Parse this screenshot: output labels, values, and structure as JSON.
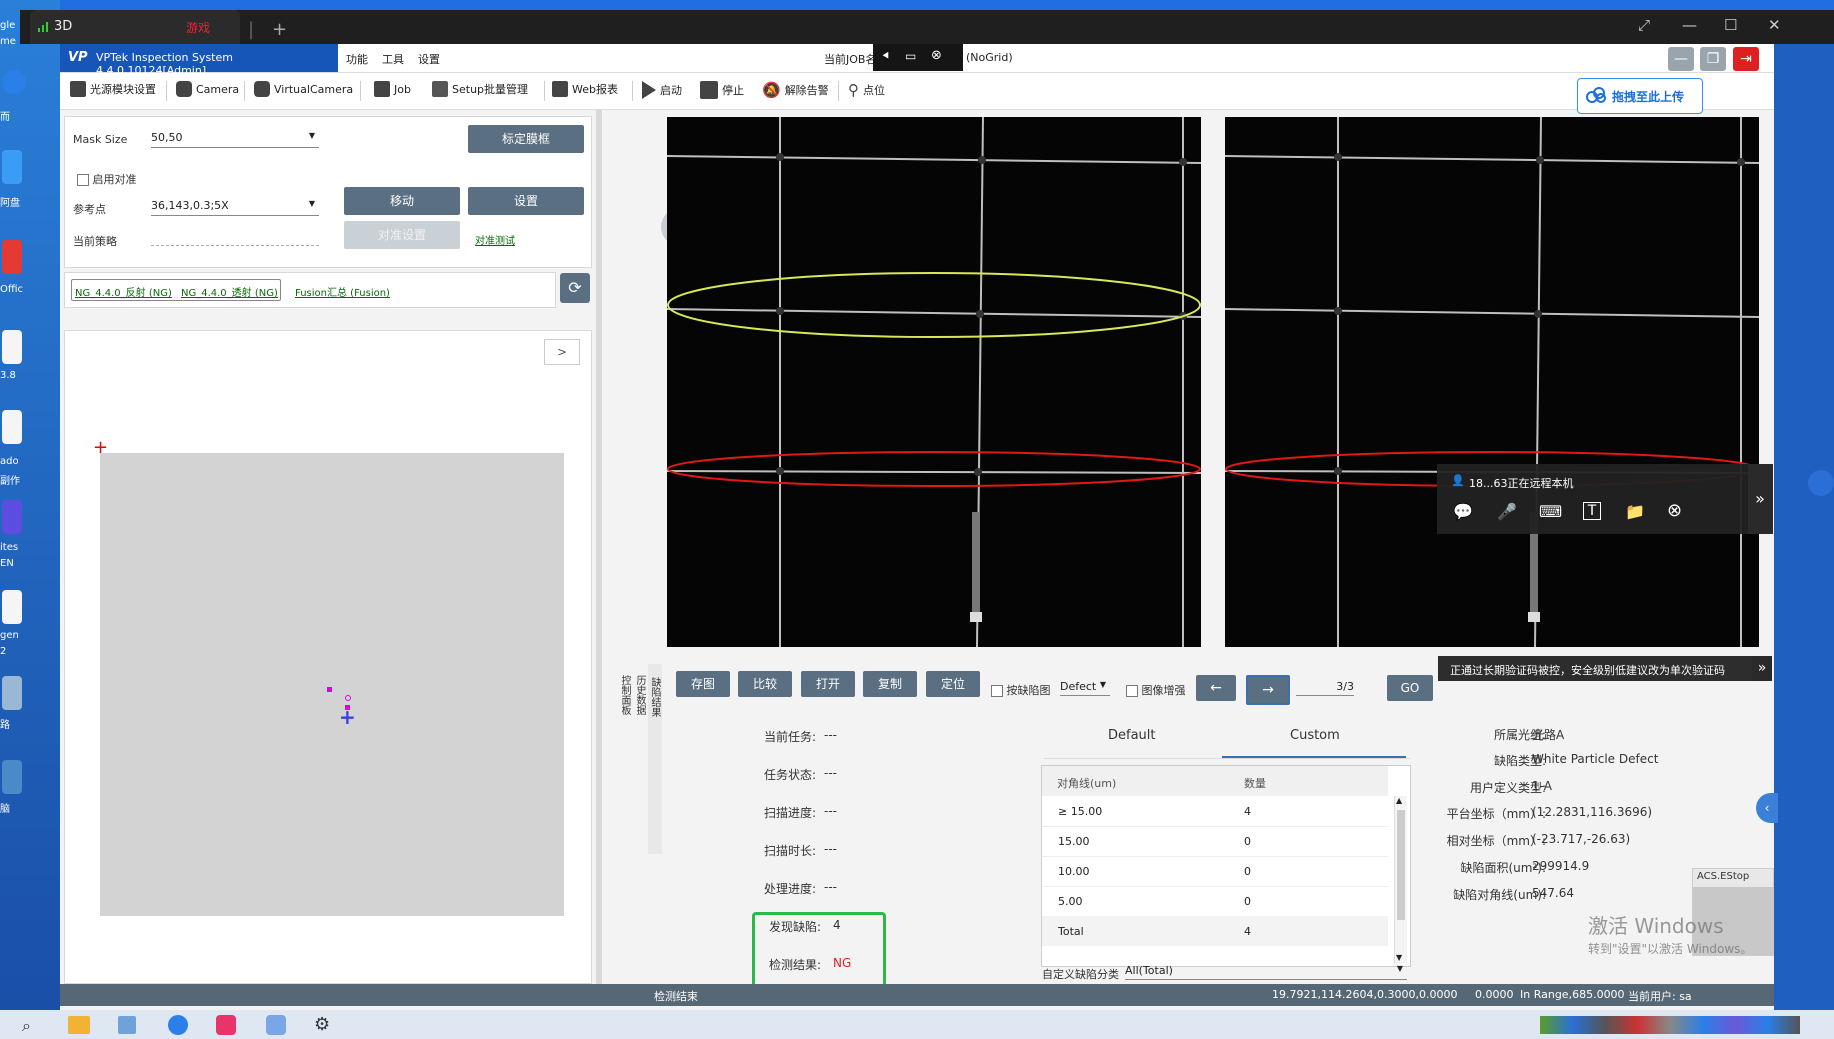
{
  "window": {
    "tab_title": "3D",
    "tab_badge": "游戏"
  },
  "app": {
    "title": "VPTek Inspection System 4.4.0.10124[Admin]",
    "menu": [
      "功能",
      "工具",
      "设置"
    ],
    "job_label": "当前JOB名",
    "grid_label": "(NoGrid)",
    "upload_label": "拖拽至此上传"
  },
  "toolbar": [
    {
      "label": "光源模块设置",
      "icon": "light-module-icon"
    },
    {
      "label": "Camera",
      "icon": "camera-icon"
    },
    {
      "label": "VirtualCamera",
      "icon": "virtual-camera-icon"
    },
    {
      "label": "Job",
      "icon": "briefcase-icon"
    },
    {
      "label": "Setup批量管理",
      "icon": "checklist-icon"
    },
    {
      "label": "Web报表",
      "icon": "web-report-icon"
    },
    {
      "label": "启动",
      "icon": "play-icon"
    },
    {
      "label": "停止",
      "icon": "stop-icon"
    },
    {
      "label": "解除告警",
      "icon": "bell-off-icon"
    },
    {
      "label": "点位",
      "icon": "location-icon"
    }
  ],
  "settings": {
    "mask_size_label": "Mask Size",
    "mask_size_value": "50,50",
    "calibrate_button": "标定膜框",
    "enable_align_label": "启用对准",
    "ref_point_label": "参考点",
    "ref_point_value": "36,143,0.3;5X",
    "move_button": "移动",
    "set_button": "设置",
    "strategy_label": "当前策略",
    "align_settings_button": "对准设置",
    "align_test_link": "对准测试"
  },
  "modes": {
    "ng_reflect": "NG_4.4.0_反射 (NG)",
    "ng_transmit": "NG_4.4.0_透射 (NG)",
    "fusion": "Fusion汇总 (Fusion)"
  },
  "map": {
    "expand_button": ">"
  },
  "side_tabs": [
    "缺陷结果",
    "历史数据",
    "控制面板"
  ],
  "result_toolbar": {
    "save": "存图",
    "compare": "比较",
    "open": "打开",
    "copy": "复制",
    "locate": "定位",
    "by_defect_map": "按缺陷图",
    "defect_select": "Defect",
    "image_enhance": "图像增强",
    "page": "3/3",
    "go": "GO"
  },
  "status": {
    "task_label": "当前任务:",
    "task_value": "---",
    "task_state_label": "任务状态:",
    "task_state_value": "---",
    "scan_progress_label": "扫描进度:",
    "scan_progress_value": "---",
    "scan_time_label": "扫描时长:",
    "scan_time_value": "---",
    "process_progress_label": "处理进度:",
    "process_progress_value": "---",
    "found_defects_label": "发现缺陷:",
    "found_defects_value": "4",
    "result_label": "检测结果:",
    "result_value": "NG"
  },
  "defect_tabs": [
    "Default",
    "Custom"
  ],
  "defect_table": {
    "headers": [
      "对角线(um)",
      "数量"
    ],
    "rows": [
      [
        "≥ 15.00",
        "4"
      ],
      [
        "15.00",
        "0"
      ],
      [
        "10.00",
        "0"
      ],
      [
        "5.00",
        "0"
      ],
      [
        "Total",
        "4"
      ]
    ]
  },
  "custom_class": {
    "label": "自定义缺陷分类",
    "value": "All(Total)"
  },
  "defect_info": [
    {
      "label": "所属光组:",
      "value": "光路A"
    },
    {
      "label": "缺陷类型:",
      "value": "White Particle Defect"
    },
    {
      "label": "用户定义类型:",
      "value": "1-A"
    },
    {
      "label": "平台坐标（mm）:",
      "value": "(12.2831,116.3696)"
    },
    {
      "label": "相对坐标（mm）:",
      "value": "(-23.717,-26.63)"
    },
    {
      "label": "缺陷面积(um²):",
      "value": "299914.9"
    },
    {
      "label": "缺陷对角线(um):",
      "value": "547.64"
    }
  ],
  "statusbar": {
    "left": "检测结束",
    "coords": "19.7921,114.2604,0.3000,0.0000",
    "zero": "0.0000",
    "range": "In Range,685.0000",
    "user": "当前用户: sa"
  },
  "remote": {
    "session_text": "18...63正在远程本机",
    "warning_text": "正通过长期验证码被控，安全级别低建议改为单次验证码"
  },
  "overlay": {
    "estop": "ACS.EStop",
    "activate_title": "激活 Windows",
    "activate_sub": "转到\"设置\"以激活 Windows。"
  },
  "desktop_labels": [
    "gle",
    "me",
    "而",
    "阿盘",
    "Offic",
    "3.8",
    "ado",
    "副作",
    "ites",
    "EN",
    "gen",
    "2",
    "路",
    "脑"
  ],
  "colors": {
    "app_blue": "#1656b9",
    "button_gray": "#5b6f82",
    "ng_red": "#e02020",
    "highlight_green": "#2db84a",
    "ellipse_yellow": "#d9e85a",
    "ellipse_red": "#e01818"
  }
}
